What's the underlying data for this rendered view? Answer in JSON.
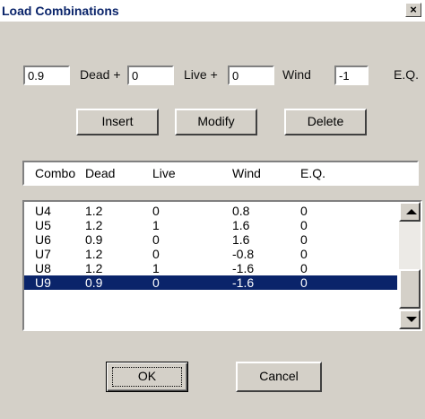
{
  "window": {
    "title": "Load Combinations",
    "close_glyph": "×"
  },
  "factors": {
    "dead_value": "0.9",
    "live_value": "0",
    "wind_value": "0",
    "eq_value": "-1",
    "dead_label": "Dead +",
    "live_label": "Live +",
    "wind_label": "Wind",
    "eq_label": "E.Q."
  },
  "actions": {
    "insert": "Insert",
    "modify": "Modify",
    "delete": "Delete"
  },
  "table": {
    "headers": [
      "Combo",
      "Dead",
      "Live",
      "Wind",
      "E.Q."
    ],
    "rows": [
      [
        "U4",
        "1.2",
        "0",
        "0.8",
        "0"
      ],
      [
        "U5",
        "1.2",
        "1",
        "1.6",
        "0"
      ],
      [
        "U6",
        "0.9",
        "0",
        "1.6",
        "0"
      ],
      [
        "U7",
        "1.2",
        "0",
        "-0.8",
        "0"
      ],
      [
        "U8",
        "1.2",
        "1",
        "-1.6",
        "0"
      ],
      [
        "U9",
        "0.9",
        "0",
        "-1.6",
        "0"
      ]
    ],
    "selected_row": 5
  },
  "footer": {
    "ok": "OK",
    "cancel": "Cancel"
  }
}
